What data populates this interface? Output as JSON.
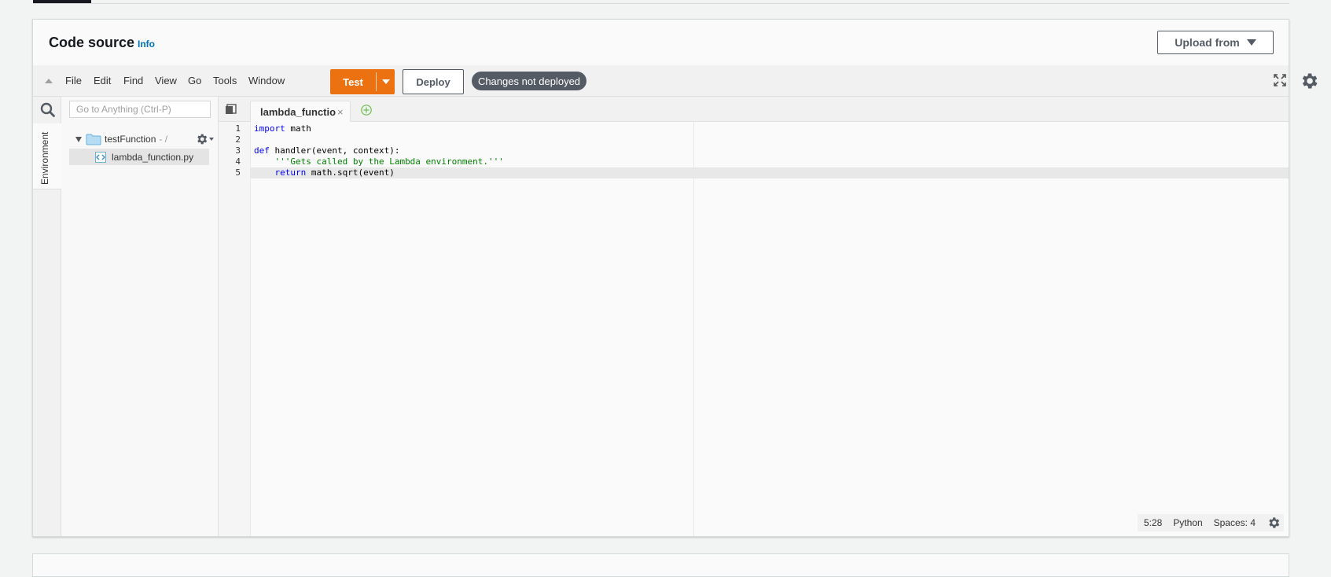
{
  "panel": {
    "title": "Code source",
    "info_link": "Info",
    "upload_label": "Upload from"
  },
  "menubar": {
    "items": [
      "File",
      "Edit",
      "Find",
      "View",
      "Go",
      "Tools",
      "Window"
    ],
    "test_label": "Test",
    "deploy_label": "Deploy",
    "changes_badge": "Changes not deployed"
  },
  "sidebar": {
    "env_tab": "Environment",
    "search_placeholder": "Go to Anything (Ctrl-P)",
    "root_folder": "testFunction",
    "root_path": "- /",
    "file": "lambda_function.py"
  },
  "editor": {
    "tab_label": "lambda_function",
    "tab_close": "×",
    "line_numbers": [
      "1",
      "2",
      "3",
      "4",
      "5"
    ],
    "active_line": 5
  },
  "statusbar": {
    "cursor": "5:28",
    "language": "Python",
    "indent": "Spaces: 4"
  },
  "colors": {
    "accent": "#ec7211",
    "badge": "#545b64",
    "link": "#0073bb",
    "keyword": "#0000ff",
    "string": "#008000"
  },
  "icons": {
    "collapse": "collapse-up-icon",
    "fullscreen": "fullscreen-icon",
    "settings": "gear-icon",
    "search": "search-icon",
    "folder": "folder-icon",
    "file": "python-file-icon",
    "add_tab": "plus-circle-icon",
    "panes": "panes-icon"
  }
}
